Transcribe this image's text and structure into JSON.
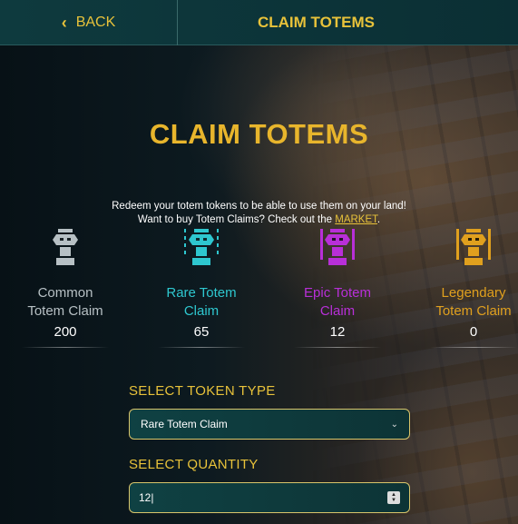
{
  "header": {
    "back_label": "BACK",
    "title": "CLAIM TOTEMS"
  },
  "main": {
    "title": "CLAIM TOTEMS",
    "line1": "Redeem your totem tokens to be able to use them on your land!",
    "line2_prefix": "Want to buy Totem Claims? Check out the ",
    "market_link": "MARKET",
    "line2_suffix": "."
  },
  "totems": [
    {
      "line1": "Common",
      "line2": "Totem Claim",
      "count": "200",
      "color": "#b7c0c4"
    },
    {
      "line1": "Rare Totem",
      "line2": "Claim",
      "count": "65",
      "color": "#2ec7cf"
    },
    {
      "line1": "Epic Totem",
      "line2": "Claim",
      "count": "12",
      "color": "#b82fd8"
    },
    {
      "line1": "Legendary",
      "line2": "Totem Claim",
      "count": "0",
      "color": "#e0a01e"
    }
  ],
  "form": {
    "token_type_label": "SELECT TOKEN TYPE",
    "token_type_value": "Rare Totem Claim",
    "quantity_label": "SELECT QUANTITY",
    "quantity_value": "12|"
  },
  "colors": {
    "accent": "#e8c23a",
    "topbar": "#0e3a3e"
  }
}
